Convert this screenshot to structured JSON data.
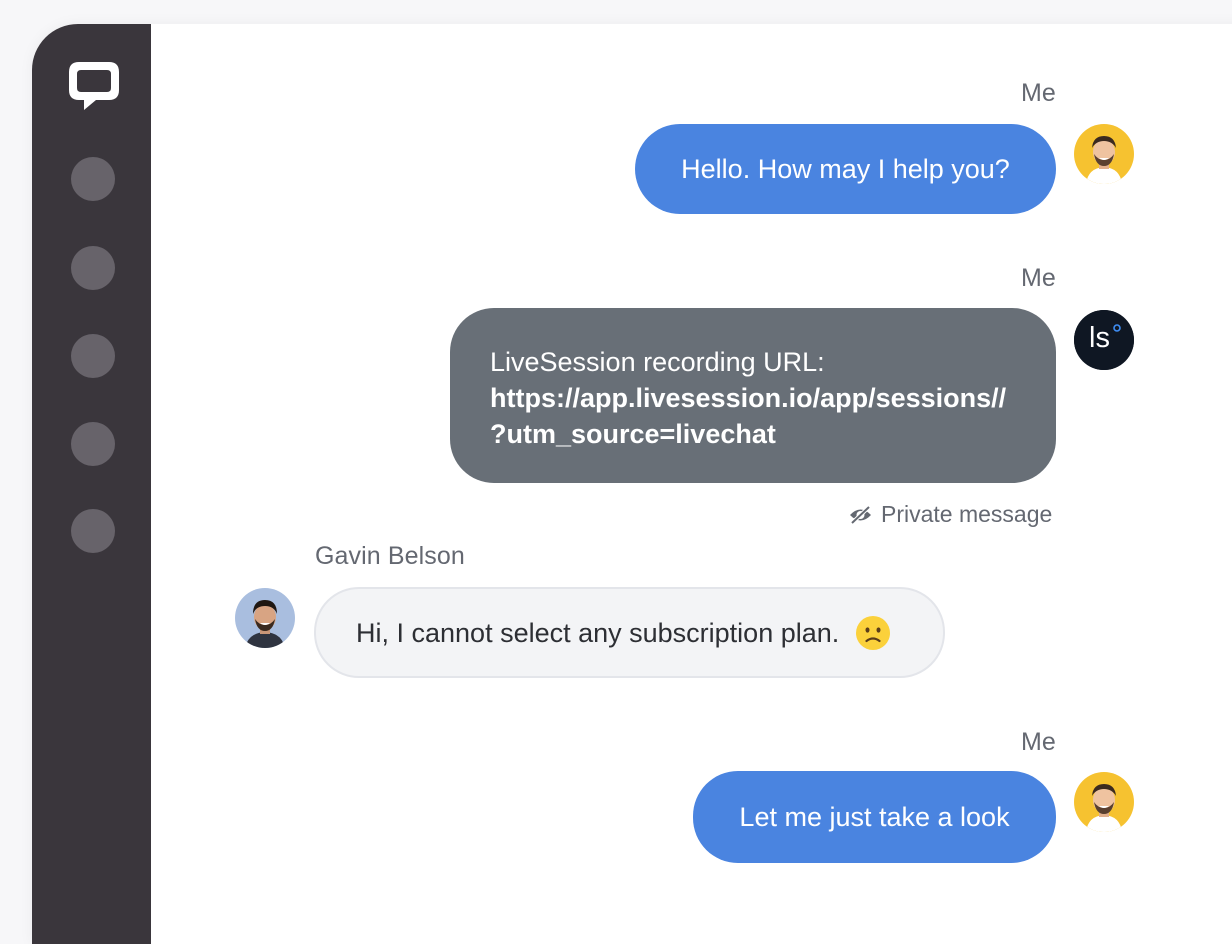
{
  "sidebar": {
    "nav_items": [
      "nav-1",
      "nav-2",
      "nav-3",
      "nav-4",
      "nav-5"
    ]
  },
  "messages": [
    {
      "sender": "Me",
      "text": "Hello. How may I help you?"
    },
    {
      "sender": "Me",
      "label": "LiveSession recording URL:",
      "url_line1": "https://app.livesession.io/app/sessions//",
      "url_line2": "?utm_source=livechat",
      "note": "Private message",
      "avatar_text": "ls"
    },
    {
      "sender": "Gavin Belson",
      "text": "Hi, I cannot select any subscription plan."
    },
    {
      "sender": "Me",
      "text": "Let me just take a look"
    }
  ],
  "colors": {
    "sidebar": "#3a363c",
    "agent_bubble": "#4a84e0",
    "private_bubble": "#686f77",
    "customer_bubble": "#f3f4f6"
  },
  "icons": [
    "livechat-logo-icon",
    "eye-off-icon",
    "sad-face-icon"
  ]
}
